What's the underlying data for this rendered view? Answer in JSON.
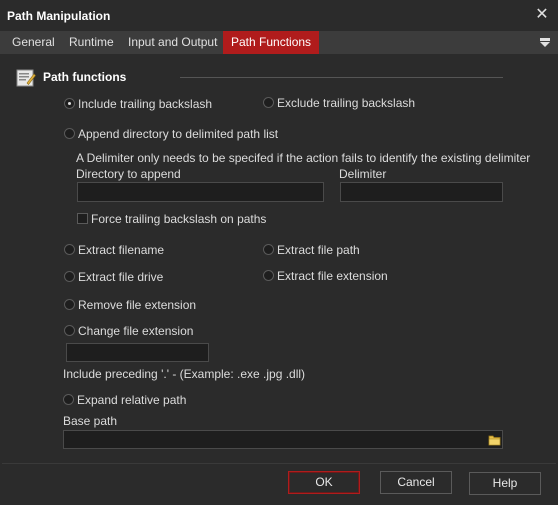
{
  "window": {
    "title": "Path Manipulation",
    "close_glyph": "✕"
  },
  "tabs": [
    {
      "label": "General"
    },
    {
      "label": "Runtime"
    },
    {
      "label": "Input and Output"
    },
    {
      "label": "Path Functions",
      "active": true
    }
  ],
  "section": {
    "title": "Path functions",
    "icon": "path-functions-icon"
  },
  "options": {
    "include_trailing": "Include trailing backslash",
    "exclude_trailing": "Exclude trailing backslash",
    "append_dir": "Append directory to delimited path list",
    "delimiter_note": "A Delimiter only needs to be specifed if the action fails to identify the existing delimiter",
    "dir_to_append_label": "Directory to append",
    "delimiter_label": "Delimiter",
    "dir_to_append_value": "",
    "delimiter_value": "",
    "force_trailing": "Force trailing backslash on paths",
    "extract_filename": "Extract filename",
    "extract_file_path": "Extract file path",
    "extract_file_drive": "Extract file drive",
    "extract_file_extension": "Extract file extension",
    "remove_file_extension": "Remove file extension",
    "change_file_extension": "Change file extension",
    "change_ext_value": "",
    "include_preceding_note": "Include preceding '.' - (Example:  .exe  .jpg  .dll)",
    "expand_relative": "Expand relative path",
    "base_path_label": "Base path",
    "base_path_value": ""
  },
  "selected_option": "include_trailing",
  "force_trailing_checked": false,
  "buttons": {
    "ok": "OK",
    "cancel": "Cancel",
    "help": "Help"
  },
  "colors": {
    "accent": "#b01c1c",
    "background": "#2b2b2b",
    "field": "#1e1e1e"
  }
}
